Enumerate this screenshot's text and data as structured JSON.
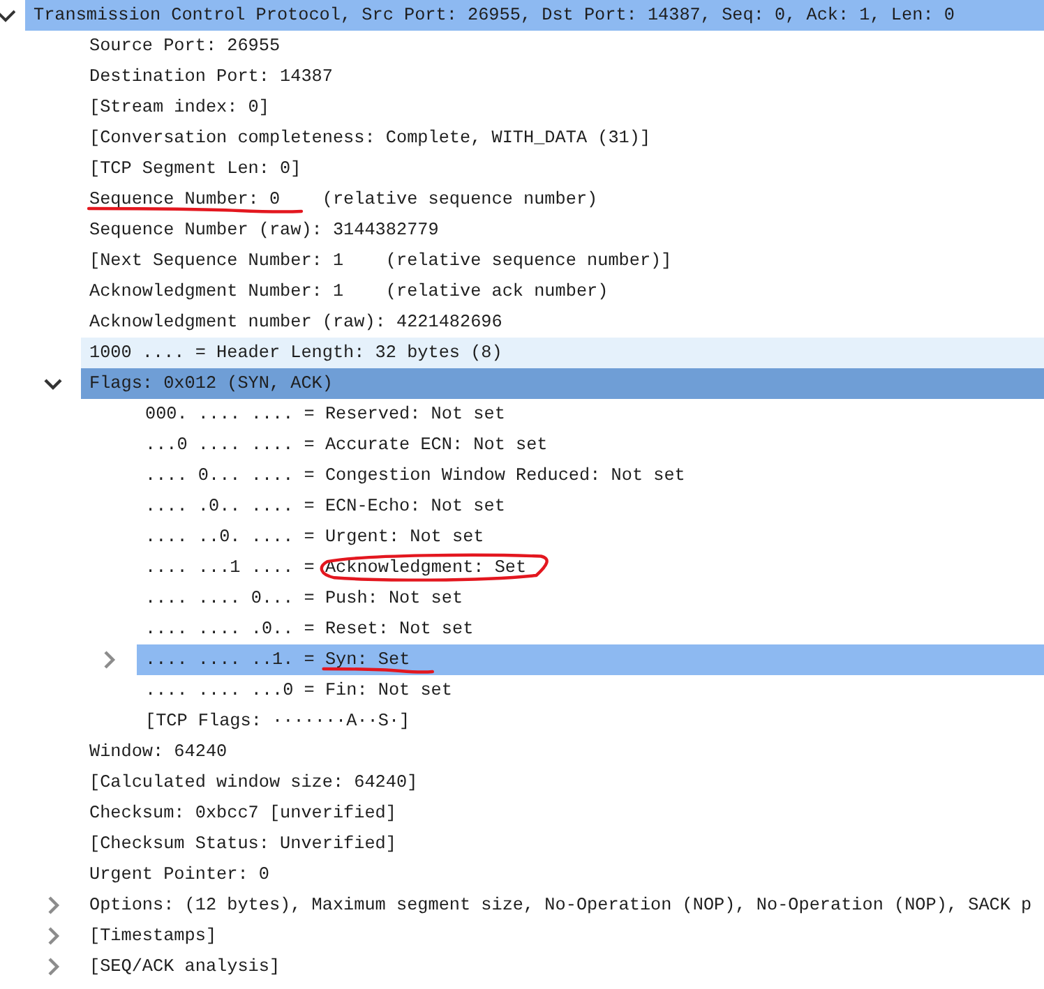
{
  "tree": [
    {
      "text": "Transmission Control Protocol, Src Port: 26955, Dst Port: 14387, Seq: 0, Ack: 1, Len: 0",
      "expanded": true,
      "selected": false,
      "highlighted": true,
      "hovered": false,
      "children": [
        {
          "text": "Source Port: 26955",
          "selected": false,
          "highlighted": false,
          "hovered": false
        },
        {
          "text": "Destination Port: 14387",
          "selected": false,
          "highlighted": false,
          "hovered": false
        },
        {
          "text": "[Stream index: 0]",
          "selected": false,
          "highlighted": false,
          "hovered": false
        },
        {
          "text": "[Conversation completeness: Complete, WITH_DATA (31)]",
          "selected": false,
          "highlighted": false,
          "hovered": false
        },
        {
          "text": "[TCP Segment Len: 0]",
          "selected": false,
          "highlighted": false,
          "hovered": false
        },
        {
          "parts": [
            {
              "kind": "underlined",
              "text": "Sequence Number: 0"
            },
            {
              "kind": "plain",
              "text": "    (relative sequence number)"
            }
          ],
          "selected": false,
          "highlighted": false,
          "hovered": false
        },
        {
          "text": "Sequence Number (raw): 3144382779",
          "selected": false,
          "highlighted": false,
          "hovered": false
        },
        {
          "text": "[Next Sequence Number: 1    (relative sequence number)]",
          "selected": false,
          "highlighted": false,
          "hovered": false
        },
        {
          "text": "Acknowledgment Number: 1    (relative ack number)",
          "selected": false,
          "highlighted": false,
          "hovered": false
        },
        {
          "text": "Acknowledgment number (raw): 4221482696",
          "selected": false,
          "highlighted": false,
          "hovered": false
        },
        {
          "text": "1000 .... = Header Length: 32 bytes (8)",
          "selected": false,
          "highlighted": false,
          "hovered": true
        },
        {
          "text": "Flags: 0x012 (SYN, ACK)",
          "expanded": true,
          "selected": true,
          "highlighted": false,
          "hovered": false,
          "children": [
            {
              "text": "000. .... .... = Reserved: Not set",
              "selected": false,
              "highlighted": false,
              "hovered": false
            },
            {
              "text": "...0 .... .... = Accurate ECN: Not set",
              "selected": false,
              "highlighted": false,
              "hovered": false
            },
            {
              "text": ".... 0... .... = Congestion Window Reduced: Not set",
              "selected": false,
              "highlighted": false,
              "hovered": false
            },
            {
              "text": ".... .0.. .... = ECN-Echo: Not set",
              "selected": false,
              "highlighted": false,
              "hovered": false
            },
            {
              "text": ".... ..0. .... = Urgent: Not set",
              "selected": false,
              "highlighted": false,
              "hovered": false
            },
            {
              "parts": [
                {
                  "kind": "plain",
                  "text": ".... ...1 .... = "
                },
                {
                  "kind": "circled",
                  "text": "Acknowledgment: Set"
                }
              ],
              "selected": false,
              "highlighted": false,
              "hovered": false
            },
            {
              "text": ".... .... 0... = Push: Not set",
              "selected": false,
              "highlighted": false,
              "hovered": false
            },
            {
              "text": ".... .... .0.. = Reset: Not set",
              "selected": false,
              "highlighted": false,
              "hovered": false
            },
            {
              "parts": [
                {
                  "kind": "plain",
                  "text": ".... .... ..1. = "
                },
                {
                  "kind": "underlined",
                  "text": "Syn: Set"
                }
              ],
              "expanded": false,
              "selected": false,
              "highlighted": true,
              "hovered": false
            },
            {
              "text": ".... .... ...0 = Fin: Not set",
              "selected": false,
              "highlighted": false,
              "hovered": false
            },
            {
              "text": "[TCP Flags: ·······A··S·]",
              "selected": false,
              "highlighted": false,
              "hovered": false
            }
          ]
        },
        {
          "text": "Window: 64240",
          "selected": false,
          "highlighted": false,
          "hovered": false
        },
        {
          "text": "[Calculated window size: 64240]",
          "selected": false,
          "highlighted": false,
          "hovered": false
        },
        {
          "text": "Checksum: 0xbcc7 [unverified]",
          "selected": false,
          "highlighted": false,
          "hovered": false
        },
        {
          "text": "[Checksum Status: Unverified]",
          "selected": false,
          "highlighted": false,
          "hovered": false
        },
        {
          "text": "Urgent Pointer: 0",
          "selected": false,
          "highlighted": false,
          "hovered": false
        },
        {
          "text": "Options: (12 bytes), Maximum segment size, No-Operation (NOP), No-Operation (NOP), SACK p",
          "expanded": false,
          "selected": false,
          "highlighted": false,
          "hovered": false
        },
        {
          "text": "[Timestamps]",
          "expanded": false,
          "selected": false,
          "highlighted": false,
          "hovered": false
        },
        {
          "text": "[SEQ/ACK analysis]",
          "expanded": false,
          "selected": false,
          "highlighted": false,
          "hovered": false
        }
      ]
    }
  ]
}
